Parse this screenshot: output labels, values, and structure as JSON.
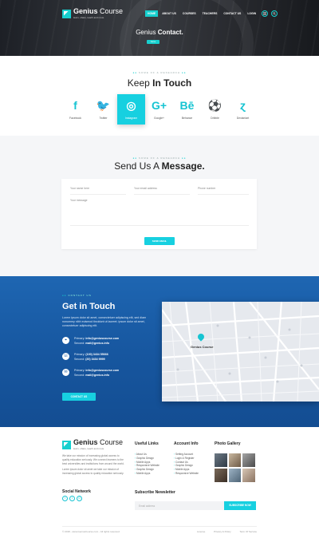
{
  "header": {
    "logo_bold": "Genius",
    "logo_thin": " Course",
    "logo_tagline": "learn, share, teach and more",
    "nav": [
      "HOME",
      "ABOUT US",
      "COURSES",
      "TEACHERS",
      "CONTACT US",
      "LOGIN"
    ],
    "active_nav": "HOME",
    "page_title_prefix": "Genius ",
    "page_title_bold": "Contact.",
    "breadcrumb": "home"
  },
  "keep_in_touch": {
    "kicker": "SOME OF & RESEARCH",
    "title_prefix": "Keep ",
    "title_bold": "In Touch",
    "socials": [
      {
        "glyph": "f",
        "label": "Facebook",
        "icon": "facebook-icon"
      },
      {
        "glyph": "🐦",
        "label": "Twitter",
        "icon": "twitter-icon"
      },
      {
        "glyph": "◎",
        "label": "Instagram",
        "icon": "instagram-icon"
      },
      {
        "glyph": "G+",
        "label": "Google+",
        "icon": "google-plus-icon"
      },
      {
        "glyph": "Bē",
        "label": "Behance",
        "icon": "behance-icon"
      },
      {
        "glyph": "⚽",
        "label": "Dribble",
        "icon": "dribbble-icon"
      },
      {
        "glyph": "ɀ",
        "label": "Deviantart",
        "icon": "deviantart-icon"
      }
    ],
    "active_social": "Instagram"
  },
  "send_message": {
    "kicker": "SOME OF & RESEARCH",
    "title_prefix": "Send Us A ",
    "title_bold": "Message.",
    "placeholders": {
      "name": "Your name here",
      "email": "Your email address",
      "phone": "Phone number",
      "message": "Your message"
    },
    "button": "SEND EMAIL"
  },
  "get_in_touch": {
    "kicker": "CONTACT US",
    "title": "Get in Touch",
    "description": "Lorem ipsum dolor sit amet, consectetuer adipiscing elit, sed diam nonummy nibh euismod tincidunt ut laoreet. ipsum dolor sit amet, consectetuer adipiscing elit.",
    "email": {
      "primary_label": "Primary:",
      "primary": "info@geniuscourse.com",
      "second_label": "Second:",
      "second": "mail@genius.info"
    },
    "phone": {
      "primary_label": "Primary:",
      "primary": "(100) 3434 55666",
      "second_label": "Second:",
      "second": "(20) 3434 9999"
    },
    "mail": {
      "primary_label": "Primary:",
      "primary": "info@geniuscourse.com",
      "second_label": "Second:",
      "second": "mail@genius.info"
    },
    "button": "CONTACT US",
    "map_label": "Genius Course"
  },
  "footer": {
    "about": "We take our mission of increasing global access to quality education seriously. We connect learners to the best universities and institutions from around the world.",
    "about2": "Lorem ipsum dolor sit amet we take our mission of increasing global access to quality education seriously.",
    "useful_links_title": "Useful Links",
    "useful_links": [
      "About Us",
      "Graphic Design",
      "Mobile Apps",
      "Responsive Website",
      "Graphic Design",
      "Mobile Apps"
    ],
    "account_title": "Account Info",
    "account_links": [
      "Setting Account",
      "Login & Register",
      "Contact Us",
      "Graphic Design",
      "Mobile Apps",
      "Responsive Website"
    ],
    "gallery_title": "Photo Gallery",
    "social_title": "Social Network",
    "social_glyphs": [
      "f",
      "t",
      "G"
    ],
    "newsletter_title": "Subscribe Newsletter",
    "newsletter_placeholder": "Email address",
    "newsletter_button": "SUBSCRIBE NOW",
    "copyright": "© 2018 - www.GeniusCourse.com - All rights reserved",
    "bottom_links": [
      "License",
      "Privacy & Policy",
      "Term Of Service"
    ]
  }
}
